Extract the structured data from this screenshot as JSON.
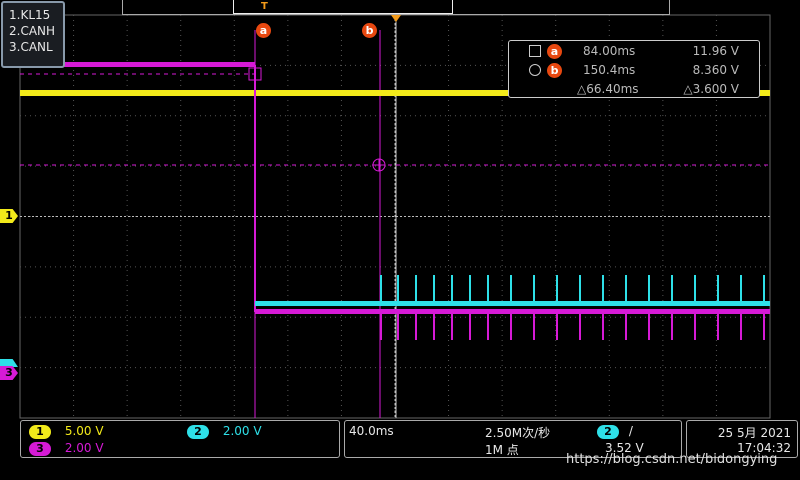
{
  "legend": [
    "1.KL15",
    "2.CANH",
    "3.CANL"
  ],
  "cursors": {
    "a": {
      "label": "a",
      "time": "84.00ms",
      "value": "11.96 V"
    },
    "b": {
      "label": "b",
      "time": "150.4ms",
      "value": "8.360 V"
    },
    "delta_time": "△66.40ms",
    "delta_value": "△3.600 V"
  },
  "channels": [
    {
      "id": "1",
      "scale": "5.00 V",
      "color": "#f2ea1a"
    },
    {
      "id": "2",
      "scale": "2.00 V",
      "color": "#2ee0e8"
    },
    {
      "id": "3",
      "scale": "2.00 V",
      "color": "#d61ad6"
    }
  ],
  "timebase": {
    "scale": "40.0ms",
    "sample_rate": "2.50M次/秒",
    "points": "1M 点"
  },
  "trigger": {
    "channel": "2",
    "slope": "/",
    "level": "3.52 V"
  },
  "datetime": {
    "date": "25 5月 2021",
    "time": "17:04:32"
  },
  "markers": {
    "trigger_top": "T"
  },
  "watermark": "https://blog.csdn.net/bidongying"
}
